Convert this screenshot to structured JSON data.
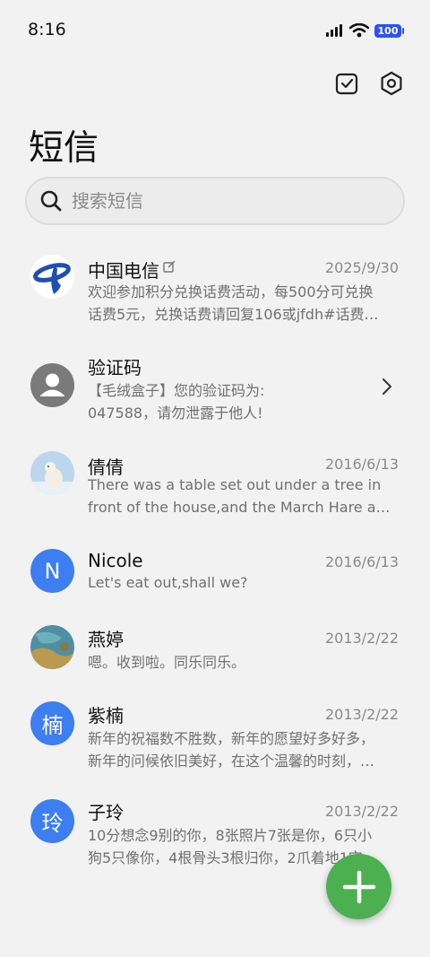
{
  "status_bar": {
    "time": "8:16",
    "battery": "100"
  },
  "header": {
    "title": "短信"
  },
  "search": {
    "placeholder": "搜索短信"
  },
  "messages": [
    {
      "name": "中国电信",
      "date": "2025/9/30",
      "line1": "欢迎参加积分兑换话费活动，每500分可兑换",
      "line2": "话费5元，兑换话费请回复106或jfdh#话费…",
      "avatar_type": "china-telecom-logo"
    },
    {
      "name": "验证码",
      "date": "",
      "line1": "【毛绒盒子】您的验证码为:",
      "line2": "047588，请勿泄露于他人!",
      "avatar_type": "default-person"
    },
    {
      "name": "倩倩",
      "date": "2016/6/13",
      "line1": "There was a table set out under a tree in",
      "line2": "front of the house,and the March Hare an…",
      "avatar_type": "polar-bear-photo"
    },
    {
      "name": "Nicole",
      "date": "2016/6/13",
      "line1": "Let's eat out,shall we?",
      "line2": "",
      "avatar_letter": "N"
    },
    {
      "name": "燕婷",
      "date": "2013/2/22",
      "line1": "嗯。收到啦。同乐同乐。",
      "line2": "",
      "avatar_type": "landscape-photo"
    },
    {
      "name": "紫楠",
      "date": "2013/2/22",
      "line1": "新年的祝福数不胜数，新年的愿望好多好多，",
      "line2": "新年的问候依旧美好，在这个温馨的时刻，…",
      "avatar_letter": "楠"
    },
    {
      "name": "子玲",
      "date": "2013/2/22",
      "line1": "10分想念9别的你，8张照片7张是你，6只小",
      "line2": "狗5只像你，4根骨头3根归你，2爪着地1宝…",
      "avatar_letter": "玲"
    }
  ],
  "colors": {
    "accent_blue": "#3d7ef0",
    "fab_green": "#4caf50",
    "battery_blue": "#2b52f2"
  }
}
